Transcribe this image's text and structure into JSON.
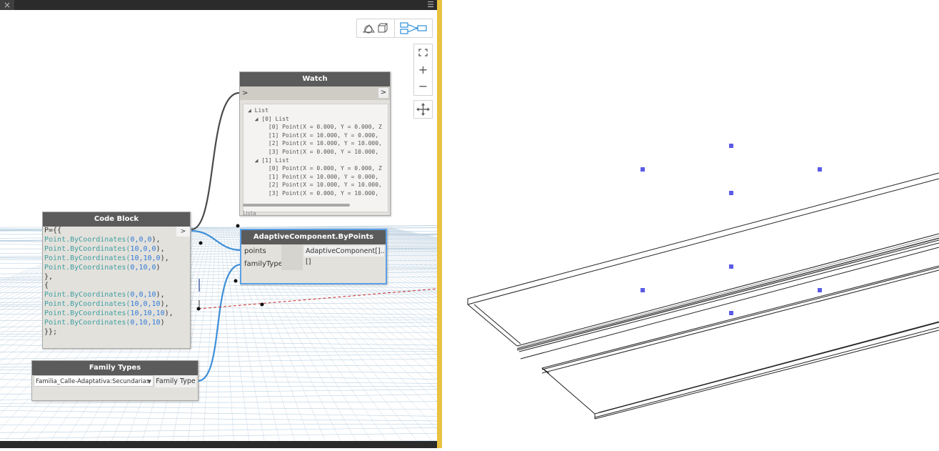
{
  "dynamo": {
    "close_icon": "×",
    "menu_icon": "☰",
    "view_toggle": {
      "geometry_icon": "geometry-view-icon",
      "graph_icon": "graph-view-icon"
    },
    "zoom": {
      "fit_icon": "zoom-fit-icon",
      "in_label": "+",
      "out_label": "−",
      "pan_icon": "pan-icon"
    },
    "watch": {
      "title": "Watch",
      "in_port": ">",
      "out_port": ">",
      "lines": [
        "◢ List",
        "  ◢ [0] List",
        "      [0] Point(X = 0.000, Y = 0.000, Z",
        "      [1] Point(X = 10.000, Y = 0.000,",
        "      [2] Point(X = 10.000, Y = 10.000,",
        "      [3] Point(X = 0.000, Y = 10.000,",
        "  ◢ [1] List",
        "      [0] Point(X = 0.000, Y = 0.000, Z",
        "      [1] Point(X = 10.000, Y = 0.000,",
        "      [2] Point(X = 10.000, Y = 10.000,",
        "      [3] Point(X = 0.000, Y = 10.000,"
      ],
      "footer": "Lista"
    },
    "code_block": {
      "title": "Code Block",
      "out_port": ">",
      "lines": [
        [
          {
            "t": "P={{",
            "c": ""
          }
        ],
        [
          {
            "t": "Point",
            "c": "fn"
          },
          {
            "t": ".ByCoordinates(",
            "c": "fn"
          },
          {
            "t": "0,0,0",
            "c": "num"
          },
          {
            "t": "),",
            "c": ""
          }
        ],
        [
          {
            "t": "Point",
            "c": "fn"
          },
          {
            "t": ".ByCoordinates(",
            "c": "fn"
          },
          {
            "t": "10,0,0",
            "c": "num"
          },
          {
            "t": "),",
            "c": ""
          }
        ],
        [
          {
            "t": "Point",
            "c": "fn"
          },
          {
            "t": ".ByCoordinates(",
            "c": "fn"
          },
          {
            "t": "10,10,0",
            "c": "num"
          },
          {
            "t": "),",
            "c": ""
          }
        ],
        [
          {
            "t": "Point",
            "c": "fn"
          },
          {
            "t": ".ByCoordinates(",
            "c": "fn"
          },
          {
            "t": "0,10,0",
            "c": "num"
          },
          {
            "t": ")",
            "c": ""
          }
        ],
        [
          {
            "t": "},",
            "c": ""
          }
        ],
        [
          {
            "t": "{",
            "c": ""
          }
        ],
        [
          {
            "t": "Point",
            "c": "fn"
          },
          {
            "t": ".ByCoordinates(",
            "c": "fn"
          },
          {
            "t": "0,0,10",
            "c": "num"
          },
          {
            "t": "),",
            "c": ""
          }
        ],
        [
          {
            "t": "Point",
            "c": "fn"
          },
          {
            "t": ".ByCoordinates(",
            "c": "fn"
          },
          {
            "t": "10,0,10",
            "c": "num"
          },
          {
            "t": "),",
            "c": ""
          }
        ],
        [
          {
            "t": "Point",
            "c": "fn"
          },
          {
            "t": ".ByCoordinates(",
            "c": "fn"
          },
          {
            "t": "10,10,10",
            "c": "num"
          },
          {
            "t": "),",
            "c": ""
          }
        ],
        [
          {
            "t": "Point",
            "c": "fn"
          },
          {
            "t": ".ByCoordinates(",
            "c": "fn"
          },
          {
            "t": "0,10,10",
            "c": "num"
          },
          {
            "t": ")",
            "c": ""
          }
        ],
        [
          {
            "t": "}};",
            "c": ""
          }
        ]
      ]
    },
    "adaptive": {
      "title": "AdaptiveComponent.ByPoints",
      "in_points": "points",
      "in_family": "familyType",
      "out": "AdaptiveComponent[]..[]"
    },
    "family_types": {
      "title": "Family Types",
      "selected": "Familia_Calle-Adaptativa:Secundarias",
      "out": "Family Type"
    }
  },
  "colors": {
    "wire_blue": "#3d8fd8",
    "wire_dark": "#4a4a4a",
    "point_blue": "#5b5be6",
    "divider": "#e8c240"
  }
}
